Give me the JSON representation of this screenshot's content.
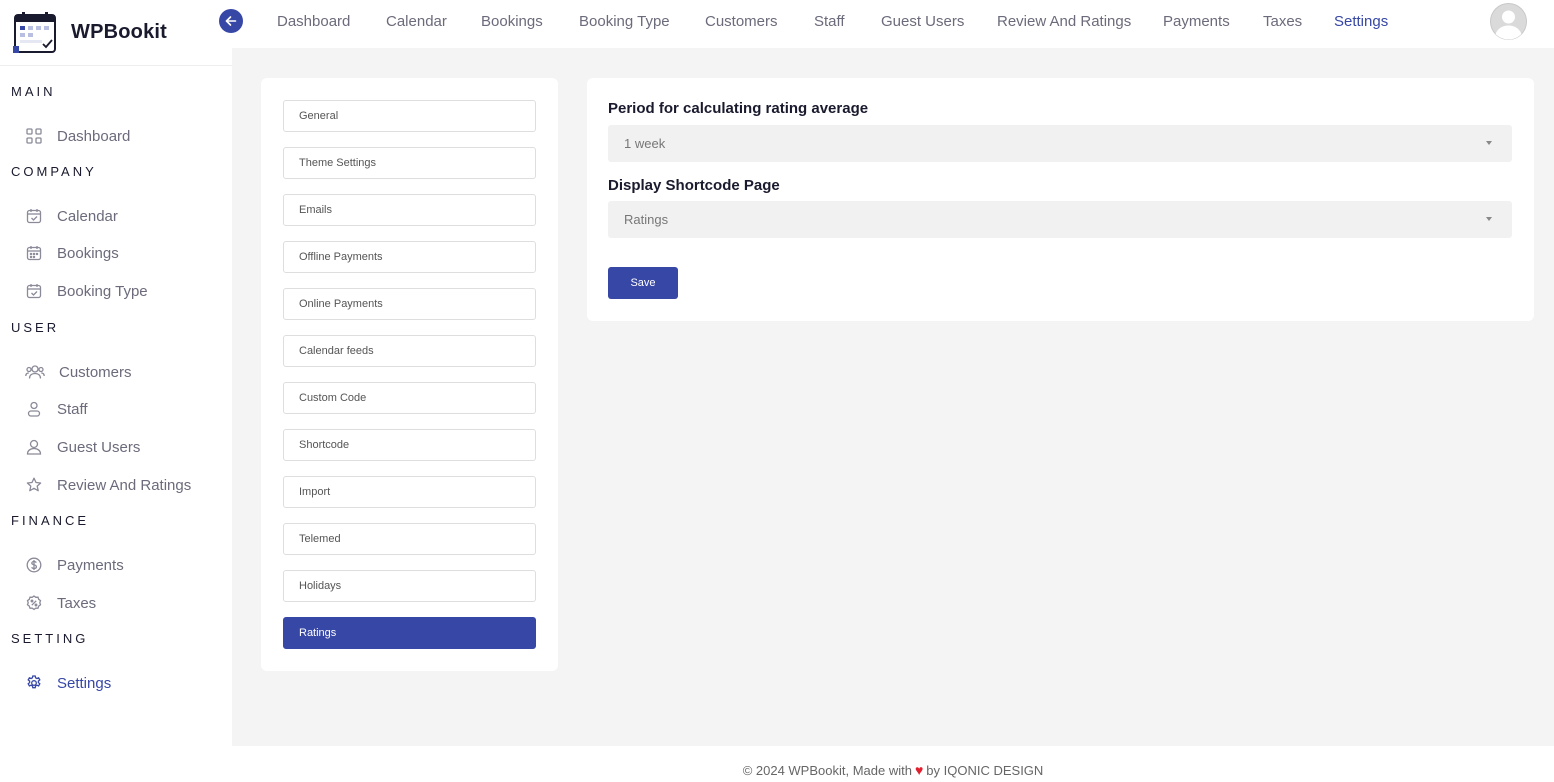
{
  "brand": {
    "name": "WPBookit"
  },
  "sidebar": {
    "sections": [
      {
        "label": "MAIN"
      },
      {
        "label": "COMPANY"
      },
      {
        "label": "USER"
      },
      {
        "label": "FINANCE"
      },
      {
        "label": "SETTING"
      }
    ],
    "items": [
      {
        "label": "Dashboard",
        "icon": "grid-icon"
      },
      {
        "label": "Calendar",
        "icon": "calendar-check-icon"
      },
      {
        "label": "Bookings",
        "icon": "calendar-icon"
      },
      {
        "label": "Booking Type",
        "icon": "calendar-check-icon"
      },
      {
        "label": "Customers",
        "icon": "users-icon"
      },
      {
        "label": "Staff",
        "icon": "user-icon"
      },
      {
        "label": "Guest Users",
        "icon": "user-outline-icon"
      },
      {
        "label": "Review And Ratings",
        "icon": "star-icon"
      },
      {
        "label": "Payments",
        "icon": "dollar-circle-icon"
      },
      {
        "label": "Taxes",
        "icon": "percent-icon"
      },
      {
        "label": "Settings",
        "icon": "gear-icon",
        "active": true
      }
    ]
  },
  "topnav": {
    "items": [
      {
        "label": "Dashboard"
      },
      {
        "label": "Calendar"
      },
      {
        "label": "Bookings"
      },
      {
        "label": "Booking Type"
      },
      {
        "label": "Customers"
      },
      {
        "label": "Staff"
      },
      {
        "label": "Guest Users"
      },
      {
        "label": "Review And Ratings"
      },
      {
        "label": "Payments"
      },
      {
        "label": "Taxes"
      },
      {
        "label": "Settings",
        "active": true
      }
    ]
  },
  "settings_menu": {
    "items": [
      {
        "label": "General"
      },
      {
        "label": "Theme Settings"
      },
      {
        "label": "Emails"
      },
      {
        "label": "Offline Payments"
      },
      {
        "label": "Online Payments"
      },
      {
        "label": "Calendar feeds"
      },
      {
        "label": "Custom Code"
      },
      {
        "label": "Shortcode"
      },
      {
        "label": "Import"
      },
      {
        "label": "Telemed"
      },
      {
        "label": "Holidays"
      },
      {
        "label": "Ratings",
        "active": true
      }
    ]
  },
  "ratings_form": {
    "period_label": "Period for calculating rating average",
    "period_value": "1 week",
    "shortcode_label": "Display Shortcode Page",
    "shortcode_value": "Ratings",
    "save_label": "Save"
  },
  "footer": {
    "prefix": "© 2024 WPBookit, Made with",
    "suffix": "by IQONIC DESIGN"
  },
  "colors": {
    "accent": "#3747a6",
    "heart": "#e0202e",
    "background": "#f4f4f4"
  }
}
